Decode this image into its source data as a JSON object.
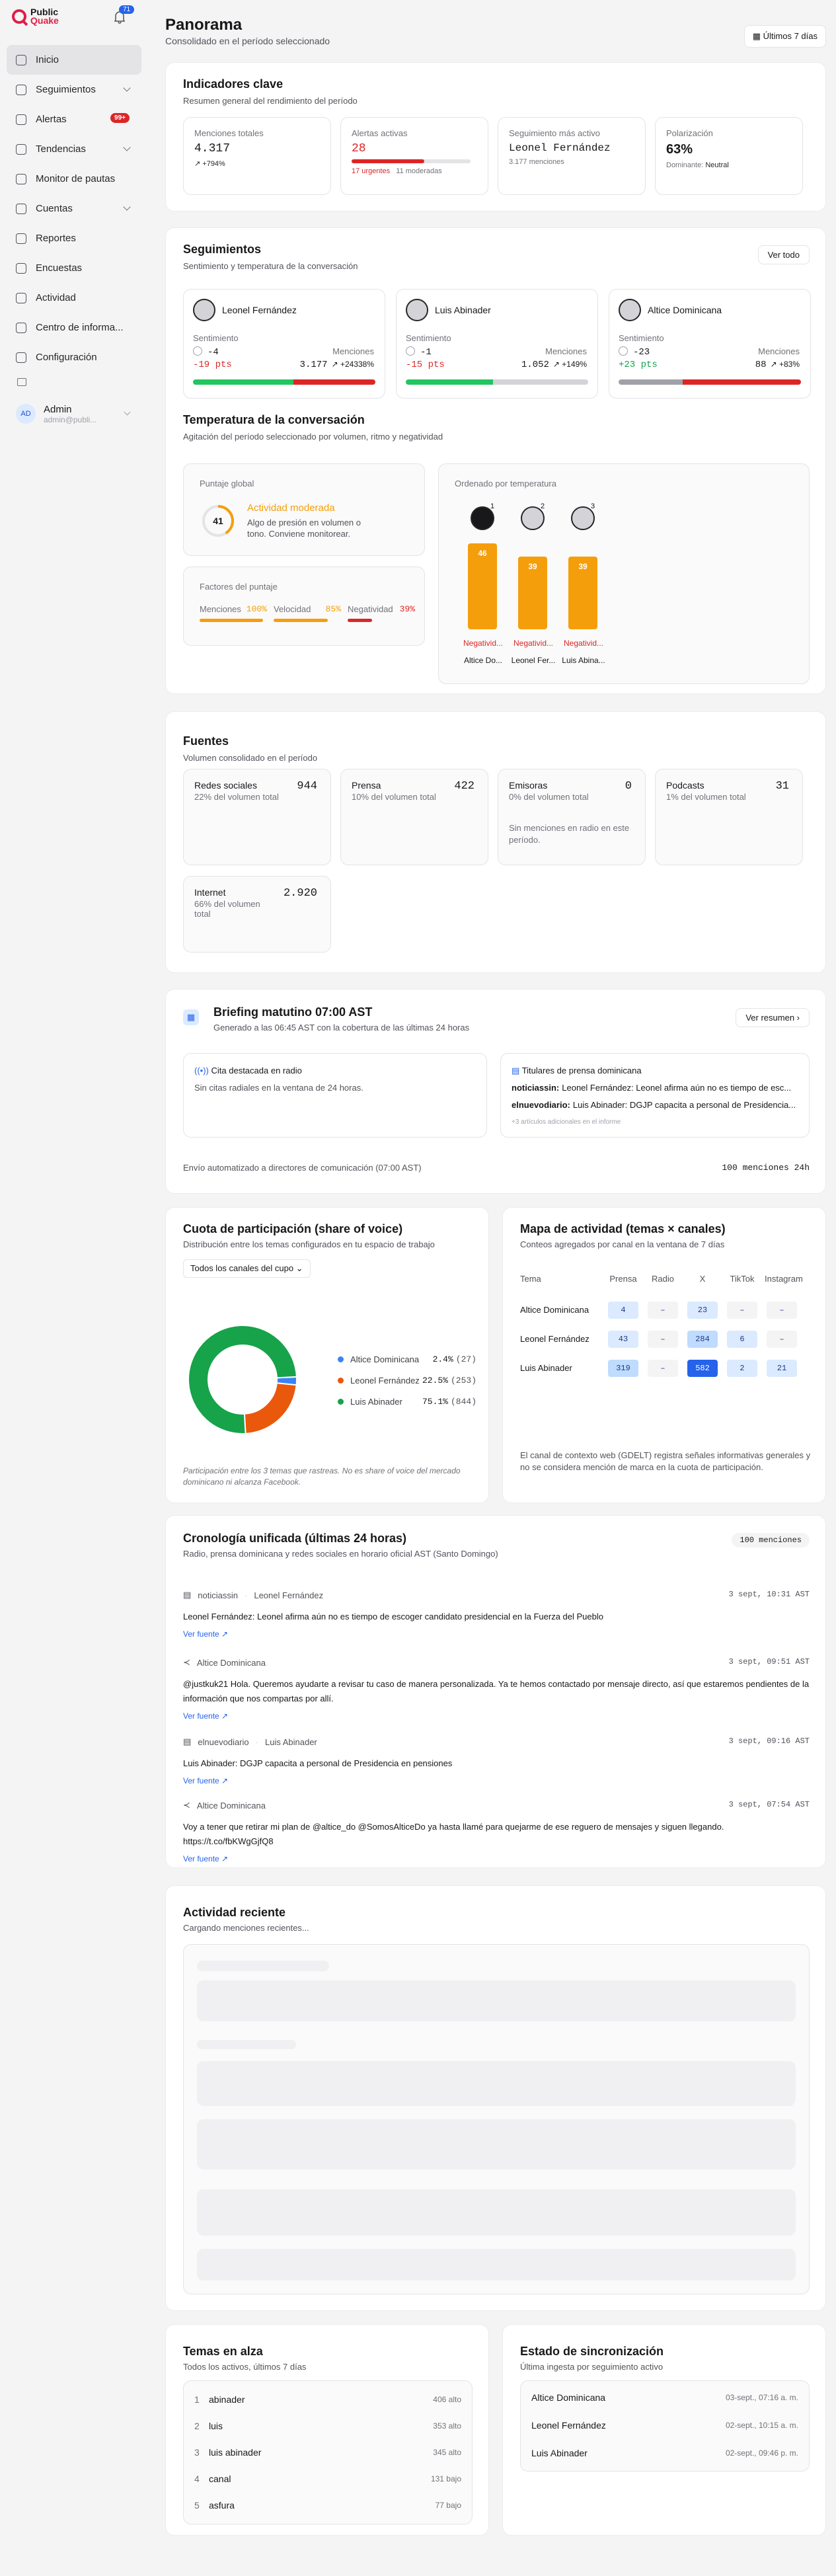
{
  "app": {
    "brand_top": "Public",
    "brand_bottom": "Quake",
    "notifications": "71"
  },
  "nav": {
    "items": [
      {
        "label": "Inicio",
        "active": true
      },
      {
        "label": "Seguimientos",
        "chevron": true
      },
      {
        "label": "Alertas",
        "badge": "99+"
      },
      {
        "label": "Tendencias",
        "chevron": true
      },
      {
        "label": "Monitor de pautas"
      },
      {
        "label": "Cuentas",
        "chevron": true
      },
      {
        "label": "Reportes"
      },
      {
        "label": "Encuestas"
      },
      {
        "label": "Actividad"
      },
      {
        "label": "Centro de informa..."
      },
      {
        "label": "Configuración"
      }
    ]
  },
  "user": {
    "initials": "AD",
    "name": "Admin",
    "email": "admin@publi..."
  },
  "header": {
    "title": "Panorama",
    "subtitle": "Consolidado en el período seleccionado",
    "range": "Últimos 7 días"
  },
  "kpis": {
    "title": "Indicadores clave",
    "subtitle": "Resumen general del rendimiento del período",
    "total": {
      "label": "Menciones totales",
      "value": "4.317",
      "delta": "↗ +794%"
    },
    "alerts": {
      "label": "Alertas activas",
      "value": "28",
      "urgent": "17 urgentes",
      "moderate": "11 moderadas",
      "urgent_share": 0.61
    },
    "most_active": {
      "label": "Seguimiento más activo",
      "value": "Leonel Fernández",
      "mentions": "3.177 menciones"
    },
    "polarization": {
      "label": "Polarización",
      "value": "63%",
      "dominant_label": "Dominante:",
      "dominant": "Neutral"
    }
  },
  "tracking": {
    "title": "Seguimientos",
    "subtitle": "Sentimiento y temperatura de la conversación",
    "view_all": "Ver todo",
    "sent_label": "Sentimiento",
    "mentions_label": "Menciones",
    "cards": [
      {
        "name": "Leonel Fernández",
        "sent": "-4",
        "sent_delta": "-19 pts",
        "mentions": "3.177",
        "mentions_delta": "↗ +24338%",
        "sent_color": "#dc2626",
        "bar": [
          0.55,
          0.45
        ]
      },
      {
        "name": "Luis Abinader",
        "sent": "-1",
        "sent_delta": "-15 pts",
        "mentions": "1.052",
        "mentions_delta": "↗ +149%",
        "sent_color": "#dc2626",
        "bar": [
          0.48,
          0.52
        ]
      },
      {
        "name": "Altice Dominicana",
        "sent": "-23",
        "sent_delta": "+23 pts",
        "mentions": "88",
        "mentions_delta": "↗ +83%",
        "sent_color": "#16a34a",
        "bar": [
          0.35,
          0.65
        ]
      }
    ]
  },
  "temperature": {
    "title": "Temperatura de la conversación",
    "subtitle": "Agitación del período seleccionado por volumen, ritmo y negatividad",
    "global_label": "Puntaje global",
    "score": "41",
    "score_fraction": 0.41,
    "level": "Actividad moderada",
    "level_desc": "Algo de presión en volumen o tono. Conviene monitorear.",
    "factors_label": "Factores del puntaje",
    "factors": [
      {
        "name": "Menciones",
        "value": "100%",
        "fill": 1.0
      },
      {
        "name": "Velocidad",
        "value": "85%",
        "fill": 0.85
      },
      {
        "name": "Negatividad",
        "value": "39%",
        "fill": 0.39
      }
    ],
    "ordered_label": "Ordenado por temperatura",
    "bars": [
      {
        "rank": "1",
        "score": 46,
        "tag": "Negativid...",
        "name": "Altice Do..."
      },
      {
        "rank": "2",
        "score": 39,
        "tag": "Negativid...",
        "name": "Leonel Fer..."
      },
      {
        "rank": "3",
        "score": 39,
        "tag": "Negativid...",
        "name": "Luis Abina..."
      }
    ]
  },
  "sources": {
    "title": "Fuentes",
    "subtitle": "Volumen consolidado en el período",
    "items": [
      {
        "name": "Redes sociales",
        "share": "22% del volumen total",
        "count": "944"
      },
      {
        "name": "Prensa",
        "share": "10% del volumen total",
        "count": "422"
      },
      {
        "name": "Emisoras",
        "share": "0% del volumen total",
        "count": "0",
        "note": "Sin menciones en radio en este período."
      },
      {
        "name": "Podcasts",
        "share": "1% del volumen total",
        "count": "31"
      },
      {
        "name": "Internet",
        "share": "66% del volumen total",
        "count": "2.920"
      }
    ]
  },
  "briefing": {
    "title": "Briefing matutino 07:00 AST",
    "subtitle": "Generado a las 06:45 AST con la cobertura de las últimas 24 horas",
    "action": "Ver resumen",
    "radio_title": "Cita destacada en radio",
    "radio_text": "Sin citas radiales en la ventana de 24 horas.",
    "press_title": "Titulares de prensa dominicana",
    "headlines": [
      {
        "source": "noticiassin:",
        "text": "Leonel Fernández: Leonel afirma aún no es tiempo de esc..."
      },
      {
        "source": "elnuevodiario:",
        "text": "Luis Abinader: DGJP capacita a personal de Presidencia..."
      }
    ],
    "more": "+3 artículos adicionales en el informe",
    "footer": "Envío automatizado a directores de comunicación (07:00 AST)",
    "count": "100 menciones 24h"
  },
  "share": {
    "title": "Cuota de participación (share of voice)",
    "subtitle": "Distribución entre los temas configurados en tu espacio de trabajo",
    "filter": "Todos los canales del cupo",
    "legend": [
      {
        "name": "Altice Dominicana",
        "pct": "2.4%",
        "count": "(27)",
        "color": "#3b82f6"
      },
      {
        "name": "Leonel Fernández",
        "pct": "22.5%",
        "count": "(253)",
        "color": "#ea580c"
      },
      {
        "name": "Luis Abinader",
        "pct": "75.1%",
        "count": "(844)",
        "color": "#16a34a"
      }
    ],
    "note": "Participación entre los 3 temas que rastreas. No es share of voice del mercado dominicano ni alcanza Facebook."
  },
  "chart_data": {
    "type": "pie",
    "categories": [
      "Altice Dominicana",
      "Leonel Fernández",
      "Luis Abinader"
    ],
    "values": [
      27,
      253,
      844
    ]
  },
  "heatmap": {
    "title": "Mapa de actividad (temas × canales)",
    "subtitle": "Conteos agregados por canal en la ventana de 7 días",
    "columns": [
      "Tema",
      "Prensa",
      "Radio",
      "X",
      "TikTok",
      "Instagram"
    ],
    "rows": [
      {
        "name": "Altice Dominicana",
        "cells": [
          "4",
          "–",
          "23",
          "–",
          "–"
        ],
        "levels": [
          1,
          0,
          1,
          0,
          0
        ]
      },
      {
        "name": "Leonel Fernández",
        "cells": [
          "43",
          "–",
          "284",
          "6",
          "–"
        ],
        "levels": [
          1,
          0,
          2,
          1,
          0
        ]
      },
      {
        "name": "Luis Abinader",
        "cells": [
          "319",
          "–",
          "582",
          "2",
          "21"
        ],
        "levels": [
          2,
          0,
          3,
          1,
          1
        ]
      }
    ],
    "note": "El canal de contexto web (GDELT) registra señales informativas generales y no se considera mención de marca en la cuota de participación."
  },
  "timeline": {
    "title": "Cronología unificada (últimas 24 horas)",
    "subtitle": "Radio, prensa dominicana y redes sociales en horario oficial AST (Santo Domingo)",
    "count": "100 menciones",
    "link": "Ver fuente ↗",
    "items": [
      {
        "source": "noticiassin",
        "topic": "Leonel Fernández",
        "time": "3 sept, 10:31 AST",
        "text": "Leonel Fernández: Leonel afirma aún no es tiempo de escoger candidato presidencial en la Fuerza del Pueblo"
      },
      {
        "source": "",
        "topic": "Altice Dominicana",
        "time": "3 sept, 09:51 AST",
        "text": "@justkuk21 Hola. Queremos ayudarte a revisar tu caso de manera personalizada. Ya te hemos contactado por mensaje directo, así que estaremos pendientes de la información que nos compartas por allí."
      },
      {
        "source": "elnuevodiario",
        "topic": "Luis Abinader",
        "time": "3 sept, 09:16 AST",
        "text": "Luis Abinader: DGJP capacita a personal de Presidencia en pensiones"
      },
      {
        "source": "",
        "topic": "Altice Dominicana",
        "time": "3 sept, 07:54 AST",
        "text": "Voy a tener que retirar mi plan de @altice_do @SomosAlticeDo ya hasta llamé para quejarme de ese reguero de mensajes y siguen llegando. https://t.co/fbKWgGjfQ8"
      }
    ]
  },
  "recent": {
    "title": "Actividad reciente",
    "subtitle": "Cargando menciones recientes..."
  },
  "trending": {
    "title": "Temas en alza",
    "subtitle": "Todos los activos, últimos 7 días",
    "items": [
      {
        "rank": "1",
        "term": "abinader",
        "count": "406 alto"
      },
      {
        "rank": "2",
        "term": "luis",
        "count": "353 alto"
      },
      {
        "rank": "3",
        "term": "luis abinader",
        "count": "345 alto"
      },
      {
        "rank": "4",
        "term": "canal",
        "count": "131 bajo"
      },
      {
        "rank": "5",
        "term": "asfura",
        "count": "77 bajo"
      }
    ]
  },
  "sync": {
    "title": "Estado de sincronización",
    "subtitle": "Última ingesta por seguimiento activo",
    "items": [
      {
        "name": "Altice Dominicana",
        "date": "03-sept., 07:16 a. m."
      },
      {
        "name": "Leonel Fernández",
        "date": "02-sept., 10:15 a. m."
      },
      {
        "name": "Luis Abinader",
        "date": "02-sept., 09:46 p. m."
      }
    ]
  }
}
